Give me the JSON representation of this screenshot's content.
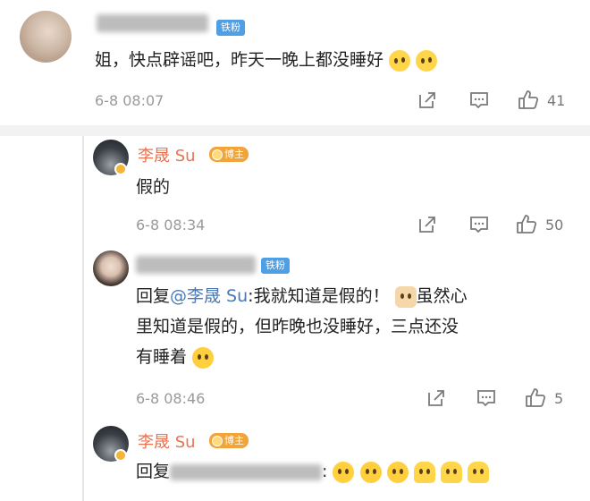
{
  "comments": [
    {
      "author_badge": "铁粉",
      "text": "姐，快点辟谣吧，昨天一晚上都没睡好",
      "time": "6-8 08:07",
      "like_count": "41"
    }
  ],
  "replies": [
    {
      "author": "李晟 Su",
      "author_badge": "博主",
      "text": "假的",
      "time": "6-8 08:34",
      "like_count": "50"
    },
    {
      "author_badge": "铁粉",
      "reply_prefix": "回复",
      "mention": "@李晟 Su",
      "text_line1": ":我就知道是假的！",
      "text_line1b": "虽然心",
      "text_line2": "里知道是假的，但昨晚也没睡好，三点还没",
      "text_line3": "有睡着",
      "time": "6-8 08:46",
      "like_count": "5"
    },
    {
      "author": "李晟 Su",
      "author_badge": "博主",
      "reply_prefix": "回复",
      "mention_suffix": ":"
    }
  ],
  "icons": {
    "share": "share-icon",
    "comment": "comment-icon",
    "like": "thumbs-up-icon"
  },
  "colors": {
    "author": "#eb7350",
    "mention": "#4a78b5",
    "fan_badge": "#4f9fe5",
    "host_badge": "#f0a43a",
    "time": "#9a9a9a"
  }
}
